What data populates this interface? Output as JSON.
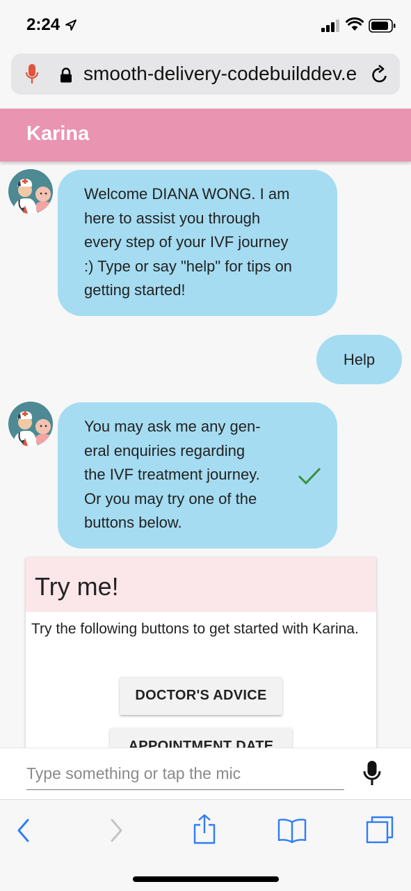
{
  "status_bar": {
    "time": "2:24"
  },
  "browser": {
    "url": "smooth-delivery-codebuilddev.example"
  },
  "app": {
    "title": "Karina"
  },
  "messages": [
    {
      "from": "bot",
      "lines": [
        "Welcome DIANA WONG. I am",
        "here to assist you through",
        "every step of your IVF journey",
        ":) Type or say \"help\" for tips on",
        "getting started!"
      ]
    },
    {
      "from": "user",
      "text": "Help"
    },
    {
      "from": "bot",
      "lines": [
        "You may ask me any gen-",
        "eral enquiries regarding",
        "the IVF treatment journey.",
        "Or you may try one of the",
        "buttons below."
      ]
    }
  ],
  "card": {
    "title": "Try me!",
    "text": "Try the following buttons to get started with Karina.",
    "buttons": [
      "DOCTOR'S ADVICE",
      "APPOINTMENT DATE"
    ]
  },
  "input": {
    "placeholder": "Type something or tap the mic"
  },
  "colors": {
    "header": "#e994b0",
    "bubble": "#a5dcf1",
    "card_header": "#fbe6ea",
    "ios_blue": "#2f7cf6",
    "check": "#3b8e3b"
  }
}
